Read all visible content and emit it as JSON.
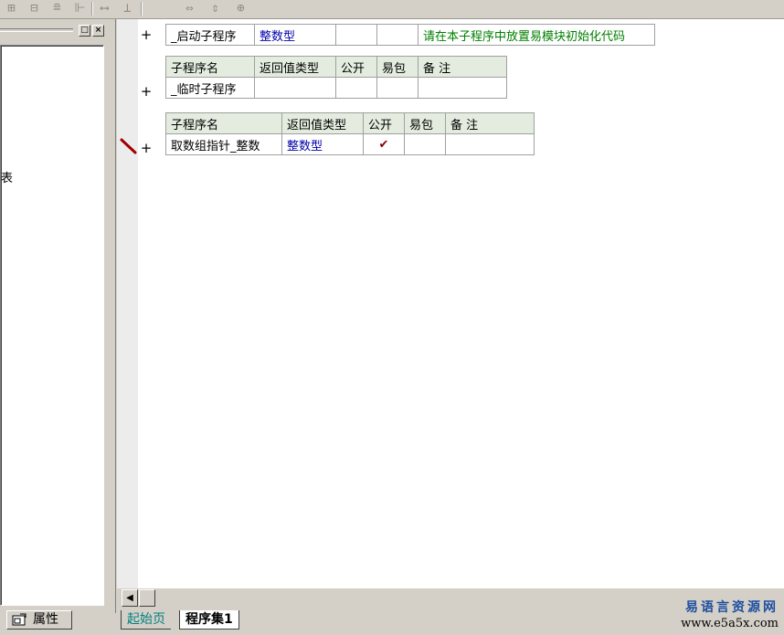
{
  "toolbar": {
    "icons": [
      "align-left-icon",
      "align-center-icon",
      "align-top-icon",
      "align-bottom-icon",
      "space-horizontal-icon",
      "space-vertical-icon",
      "width-icon",
      "height-icon",
      "size-icon"
    ]
  },
  "left_panel": {
    "tree_fragment": "表",
    "tab_label": "属性"
  },
  "editor": {
    "sub1": {
      "name": "_启动子程序",
      "return_type": "整数型",
      "public": "",
      "easy_pack": "",
      "note": "请在本子程序中放置易模块初始化代码"
    },
    "headers": {
      "name": "子程序名",
      "return_type": "返回值类型",
      "public": "公开",
      "easy_pack": "易包",
      "note": "备 注"
    },
    "sub2": {
      "name": "_临时子程序",
      "return_type": "",
      "public": "",
      "easy_pack": "",
      "note": ""
    },
    "sub3": {
      "name": "取数组指针_整数",
      "return_type": "整数型",
      "public": "✔",
      "easy_pack": "",
      "note": ""
    },
    "plus": "+"
  },
  "tabs": {
    "start": "起始页",
    "program_set": "程序集1"
  },
  "watermark": {
    "line1": "易语言资源网",
    "line2": "www.e5a5x.com"
  },
  "colors": {
    "header_bg": "#e4ecdf",
    "type_text": "#0000aa",
    "note_text": "#008000",
    "check": "#8b0000"
  }
}
